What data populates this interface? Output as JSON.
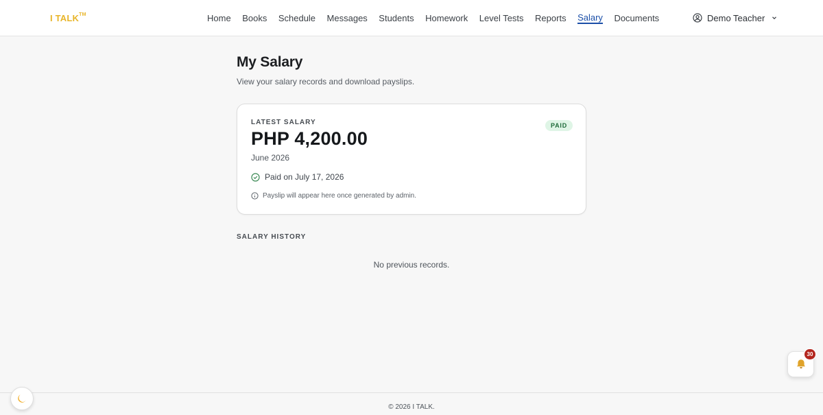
{
  "header": {
    "logo": "I TALK",
    "logo_tm": "TM",
    "nav": [
      {
        "label": "Home"
      },
      {
        "label": "Books"
      },
      {
        "label": "Schedule"
      },
      {
        "label": "Messages"
      },
      {
        "label": "Students"
      },
      {
        "label": "Homework"
      },
      {
        "label": "Level Tests"
      },
      {
        "label": "Reports"
      },
      {
        "label": "Salary",
        "active": true
      },
      {
        "label": "Documents"
      }
    ],
    "user": {
      "name": "Demo Teacher",
      "icon": "user-circle-icon",
      "dropdown_icon": "chevron-down-icon"
    }
  },
  "page": {
    "title": "My Salary",
    "subtitle": "View your salary records and download payslips."
  },
  "latest_salary": {
    "label": "LATEST SALARY",
    "amount": "PHP 4,200.00",
    "period": "June 2026",
    "status_badge": "PAID",
    "paid_text": "Paid on July 17, 2026",
    "paid_icon": "check-circle-icon",
    "note": "Payslip will appear here once generated by admin.",
    "note_icon": "info-icon"
  },
  "history": {
    "title": "SALARY HISTORY",
    "empty_text": "No previous records."
  },
  "footer": {
    "text": "© 2026 I TALK."
  },
  "floating": {
    "theme_icon": "moon-icon",
    "notification_icon": "bell-icon",
    "notification_count": "30"
  },
  "colors": {
    "brand": "#e8b52a",
    "active_nav": "#1b4fa8",
    "paid_badge_bg": "#dff5e6",
    "paid_badge_text": "#1f6b3a",
    "paid_check": "#3c8a55",
    "notification_badge": "#b3261e"
  }
}
